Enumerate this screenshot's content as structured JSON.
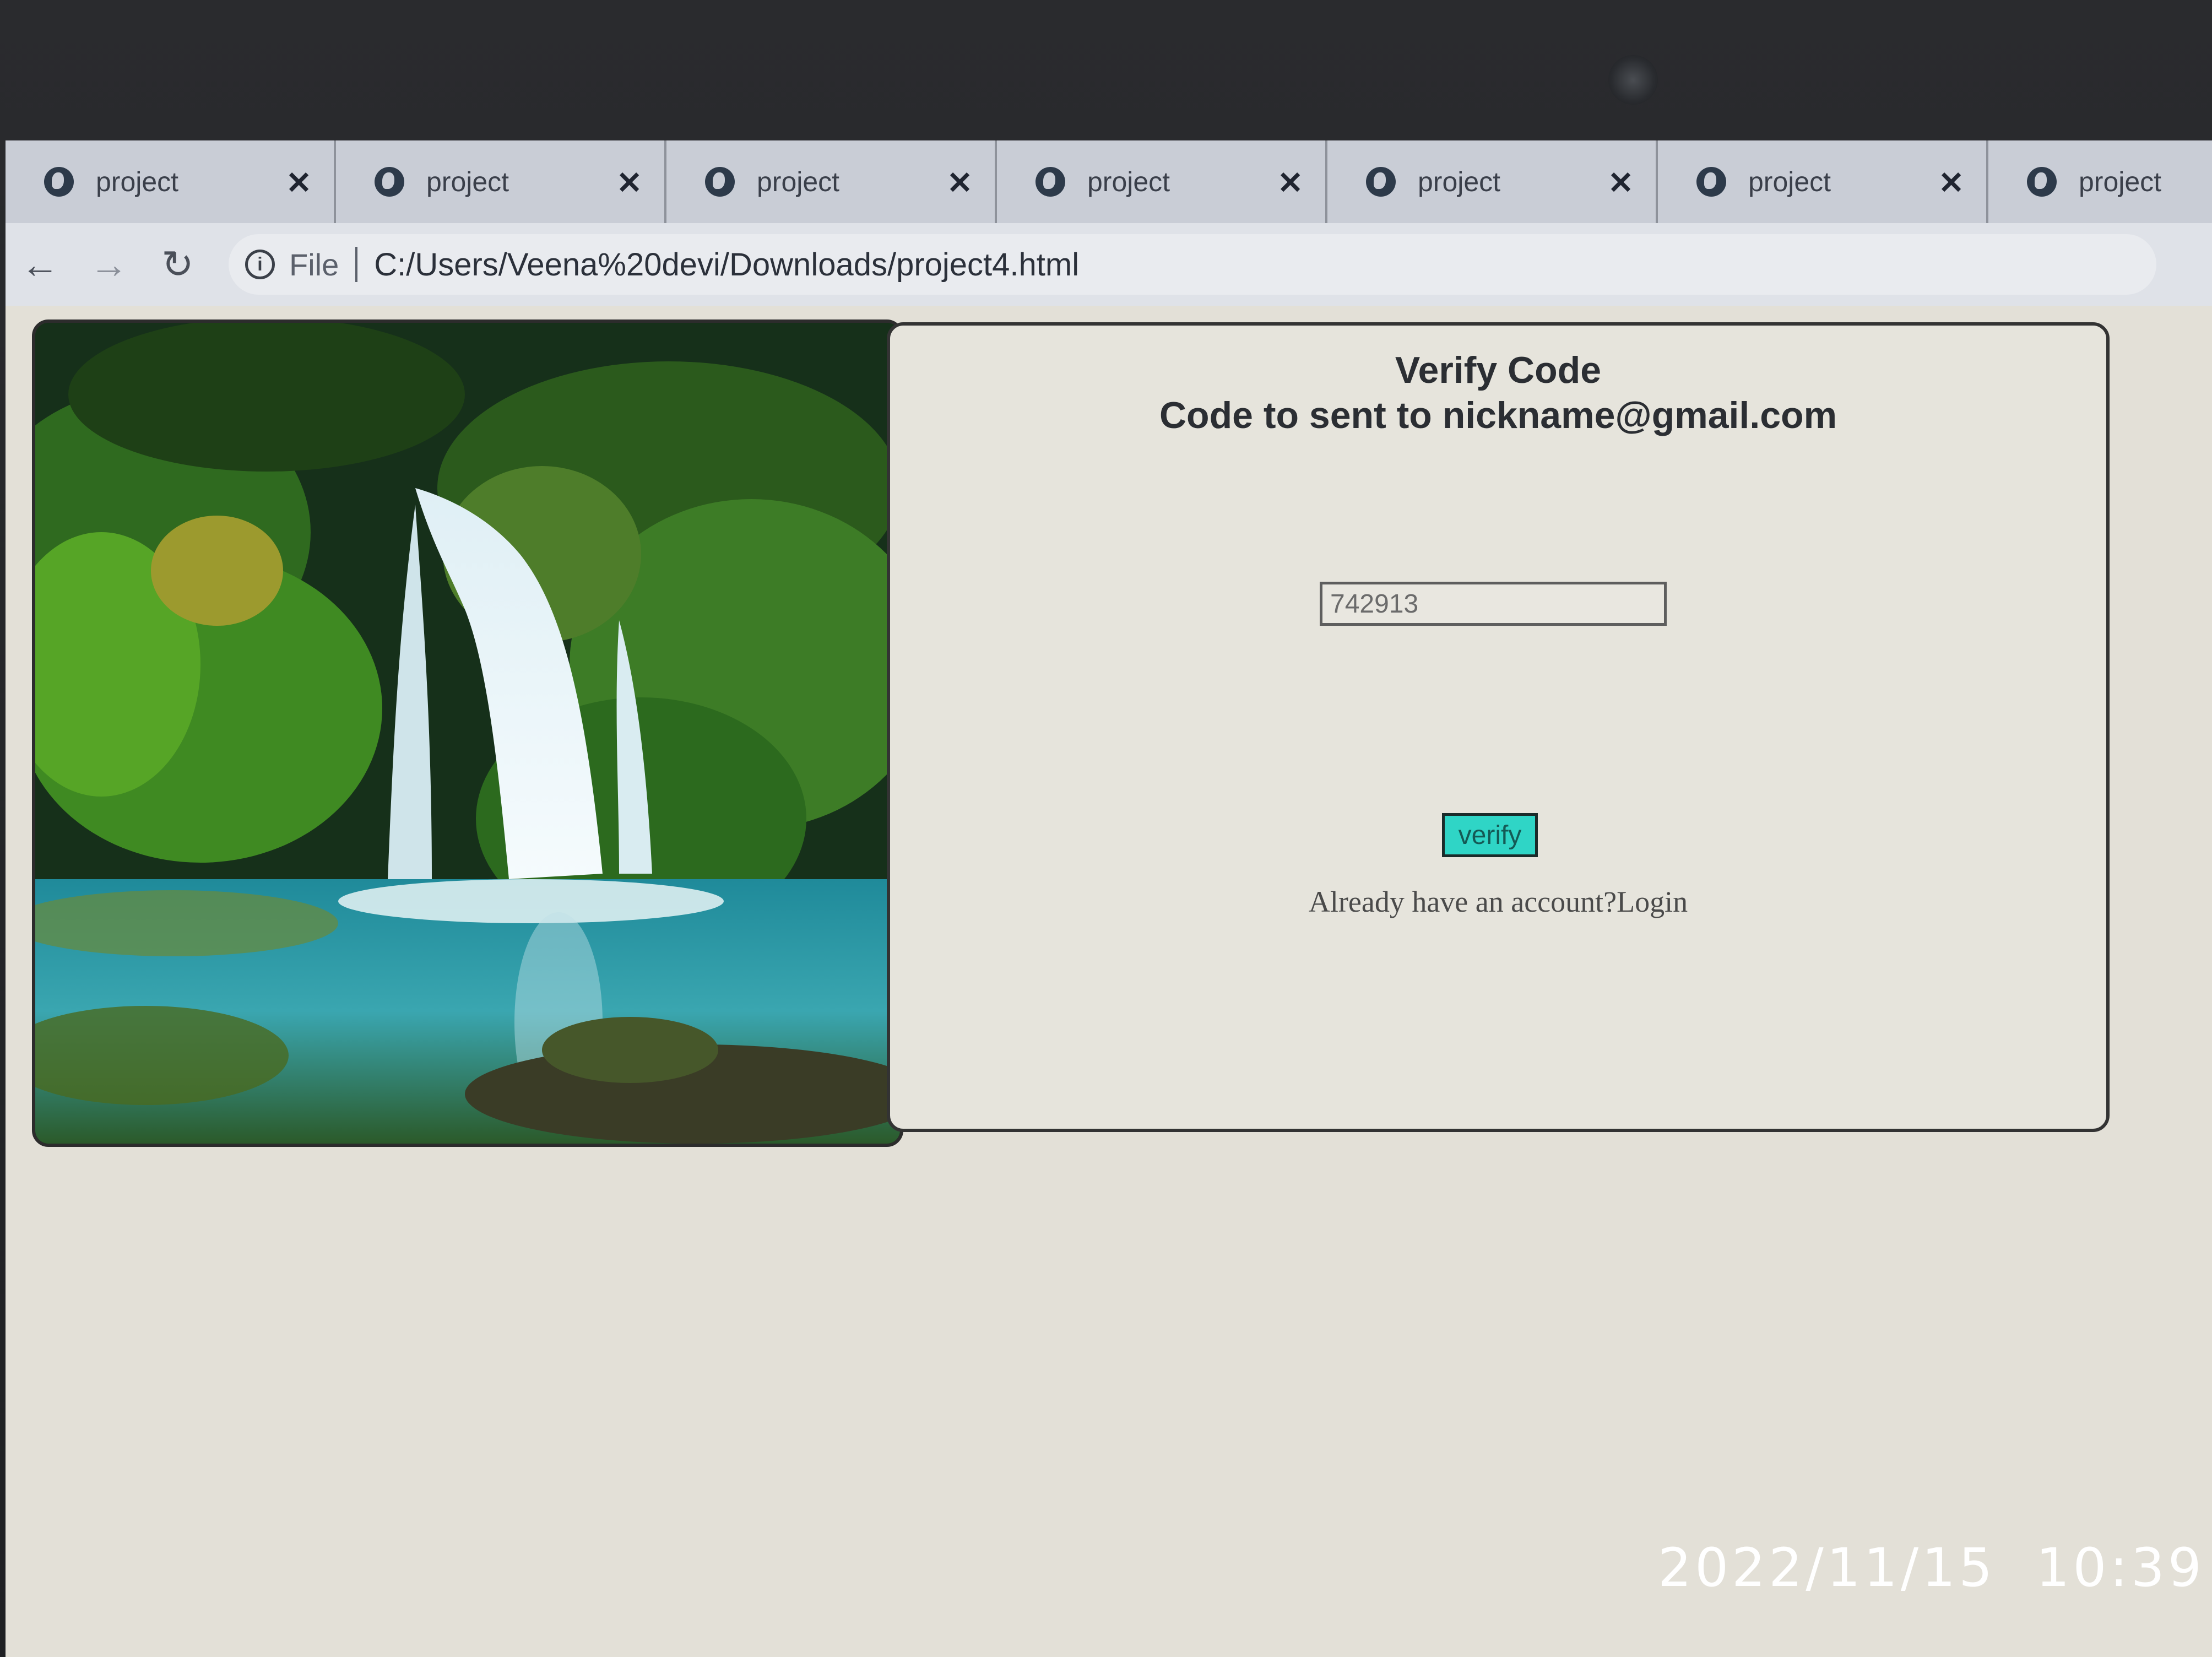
{
  "browser": {
    "tabs": [
      {
        "title": "project"
      },
      {
        "title": "project"
      },
      {
        "title": "project"
      },
      {
        "title": "project"
      },
      {
        "title": "project"
      },
      {
        "title": "project"
      },
      {
        "title": "project"
      }
    ],
    "address": {
      "scheme_label": "File",
      "url": "C:/Users/Veena%20devi/Downloads/project4.html"
    }
  },
  "page": {
    "heading_line1": "Verify Code",
    "heading_line2": "Code to sent to nickname@gmail.com",
    "code_input_value": "742913",
    "verify_button_label": "verify",
    "login_prompt": "Already have an account?Login",
    "accent_color": "#2fd5c6"
  },
  "photo_timestamp": "2022/11/15  10:39"
}
